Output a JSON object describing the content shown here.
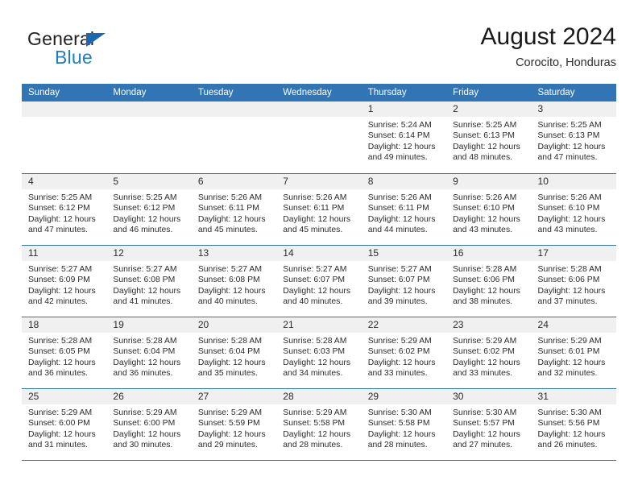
{
  "brand": {
    "name_part1": "General",
    "name_part2": "Blue",
    "triangle_color": "#1b68b0",
    "blue_color": "#1b7ec6"
  },
  "header": {
    "title": "August 2024",
    "location": "Corocito, Honduras"
  },
  "theme": {
    "header_blue": "#3175b5",
    "date_band_gray": "#f0f0f0",
    "text_color": "#2b2b2b"
  },
  "weekdays": [
    "Sunday",
    "Monday",
    "Tuesday",
    "Wednesday",
    "Thursday",
    "Friday",
    "Saturday"
  ],
  "weeks": [
    [
      {
        "day": "",
        "sunrise": "",
        "sunset": "",
        "daylight1": "",
        "daylight2": ""
      },
      {
        "day": "",
        "sunrise": "",
        "sunset": "",
        "daylight1": "",
        "daylight2": ""
      },
      {
        "day": "",
        "sunrise": "",
        "sunset": "",
        "daylight1": "",
        "daylight2": ""
      },
      {
        "day": "",
        "sunrise": "",
        "sunset": "",
        "daylight1": "",
        "daylight2": ""
      },
      {
        "day": "1",
        "sunrise": "Sunrise: 5:24 AM",
        "sunset": "Sunset: 6:14 PM",
        "daylight1": "Daylight: 12 hours",
        "daylight2": "and 49 minutes."
      },
      {
        "day": "2",
        "sunrise": "Sunrise: 5:25 AM",
        "sunset": "Sunset: 6:13 PM",
        "daylight1": "Daylight: 12 hours",
        "daylight2": "and 48 minutes."
      },
      {
        "day": "3",
        "sunrise": "Sunrise: 5:25 AM",
        "sunset": "Sunset: 6:13 PM",
        "daylight1": "Daylight: 12 hours",
        "daylight2": "and 47 minutes."
      }
    ],
    [
      {
        "day": "4",
        "sunrise": "Sunrise: 5:25 AM",
        "sunset": "Sunset: 6:12 PM",
        "daylight1": "Daylight: 12 hours",
        "daylight2": "and 47 minutes."
      },
      {
        "day": "5",
        "sunrise": "Sunrise: 5:25 AM",
        "sunset": "Sunset: 6:12 PM",
        "daylight1": "Daylight: 12 hours",
        "daylight2": "and 46 minutes."
      },
      {
        "day": "6",
        "sunrise": "Sunrise: 5:26 AM",
        "sunset": "Sunset: 6:11 PM",
        "daylight1": "Daylight: 12 hours",
        "daylight2": "and 45 minutes."
      },
      {
        "day": "7",
        "sunrise": "Sunrise: 5:26 AM",
        "sunset": "Sunset: 6:11 PM",
        "daylight1": "Daylight: 12 hours",
        "daylight2": "and 45 minutes."
      },
      {
        "day": "8",
        "sunrise": "Sunrise: 5:26 AM",
        "sunset": "Sunset: 6:11 PM",
        "daylight1": "Daylight: 12 hours",
        "daylight2": "and 44 minutes."
      },
      {
        "day": "9",
        "sunrise": "Sunrise: 5:26 AM",
        "sunset": "Sunset: 6:10 PM",
        "daylight1": "Daylight: 12 hours",
        "daylight2": "and 43 minutes."
      },
      {
        "day": "10",
        "sunrise": "Sunrise: 5:26 AM",
        "sunset": "Sunset: 6:10 PM",
        "daylight1": "Daylight: 12 hours",
        "daylight2": "and 43 minutes."
      }
    ],
    [
      {
        "day": "11",
        "sunrise": "Sunrise: 5:27 AM",
        "sunset": "Sunset: 6:09 PM",
        "daylight1": "Daylight: 12 hours",
        "daylight2": "and 42 minutes."
      },
      {
        "day": "12",
        "sunrise": "Sunrise: 5:27 AM",
        "sunset": "Sunset: 6:08 PM",
        "daylight1": "Daylight: 12 hours",
        "daylight2": "and 41 minutes."
      },
      {
        "day": "13",
        "sunrise": "Sunrise: 5:27 AM",
        "sunset": "Sunset: 6:08 PM",
        "daylight1": "Daylight: 12 hours",
        "daylight2": "and 40 minutes."
      },
      {
        "day": "14",
        "sunrise": "Sunrise: 5:27 AM",
        "sunset": "Sunset: 6:07 PM",
        "daylight1": "Daylight: 12 hours",
        "daylight2": "and 40 minutes."
      },
      {
        "day": "15",
        "sunrise": "Sunrise: 5:27 AM",
        "sunset": "Sunset: 6:07 PM",
        "daylight1": "Daylight: 12 hours",
        "daylight2": "and 39 minutes."
      },
      {
        "day": "16",
        "sunrise": "Sunrise: 5:28 AM",
        "sunset": "Sunset: 6:06 PM",
        "daylight1": "Daylight: 12 hours",
        "daylight2": "and 38 minutes."
      },
      {
        "day": "17",
        "sunrise": "Sunrise: 5:28 AM",
        "sunset": "Sunset: 6:06 PM",
        "daylight1": "Daylight: 12 hours",
        "daylight2": "and 37 minutes."
      }
    ],
    [
      {
        "day": "18",
        "sunrise": "Sunrise: 5:28 AM",
        "sunset": "Sunset: 6:05 PM",
        "daylight1": "Daylight: 12 hours",
        "daylight2": "and 36 minutes."
      },
      {
        "day": "19",
        "sunrise": "Sunrise: 5:28 AM",
        "sunset": "Sunset: 6:04 PM",
        "daylight1": "Daylight: 12 hours",
        "daylight2": "and 36 minutes."
      },
      {
        "day": "20",
        "sunrise": "Sunrise: 5:28 AM",
        "sunset": "Sunset: 6:04 PM",
        "daylight1": "Daylight: 12 hours",
        "daylight2": "and 35 minutes."
      },
      {
        "day": "21",
        "sunrise": "Sunrise: 5:28 AM",
        "sunset": "Sunset: 6:03 PM",
        "daylight1": "Daylight: 12 hours",
        "daylight2": "and 34 minutes."
      },
      {
        "day": "22",
        "sunrise": "Sunrise: 5:29 AM",
        "sunset": "Sunset: 6:02 PM",
        "daylight1": "Daylight: 12 hours",
        "daylight2": "and 33 minutes."
      },
      {
        "day": "23",
        "sunrise": "Sunrise: 5:29 AM",
        "sunset": "Sunset: 6:02 PM",
        "daylight1": "Daylight: 12 hours",
        "daylight2": "and 33 minutes."
      },
      {
        "day": "24",
        "sunrise": "Sunrise: 5:29 AM",
        "sunset": "Sunset: 6:01 PM",
        "daylight1": "Daylight: 12 hours",
        "daylight2": "and 32 minutes."
      }
    ],
    [
      {
        "day": "25",
        "sunrise": "Sunrise: 5:29 AM",
        "sunset": "Sunset: 6:00 PM",
        "daylight1": "Daylight: 12 hours",
        "daylight2": "and 31 minutes."
      },
      {
        "day": "26",
        "sunrise": "Sunrise: 5:29 AM",
        "sunset": "Sunset: 6:00 PM",
        "daylight1": "Daylight: 12 hours",
        "daylight2": "and 30 minutes."
      },
      {
        "day": "27",
        "sunrise": "Sunrise: 5:29 AM",
        "sunset": "Sunset: 5:59 PM",
        "daylight1": "Daylight: 12 hours",
        "daylight2": "and 29 minutes."
      },
      {
        "day": "28",
        "sunrise": "Sunrise: 5:29 AM",
        "sunset": "Sunset: 5:58 PM",
        "daylight1": "Daylight: 12 hours",
        "daylight2": "and 28 minutes."
      },
      {
        "day": "29",
        "sunrise": "Sunrise: 5:30 AM",
        "sunset": "Sunset: 5:58 PM",
        "daylight1": "Daylight: 12 hours",
        "daylight2": "and 28 minutes."
      },
      {
        "day": "30",
        "sunrise": "Sunrise: 5:30 AM",
        "sunset": "Sunset: 5:57 PM",
        "daylight1": "Daylight: 12 hours",
        "daylight2": "and 27 minutes."
      },
      {
        "day": "31",
        "sunrise": "Sunrise: 5:30 AM",
        "sunset": "Sunset: 5:56 PM",
        "daylight1": "Daylight: 12 hours",
        "daylight2": "and 26 minutes."
      }
    ]
  ]
}
